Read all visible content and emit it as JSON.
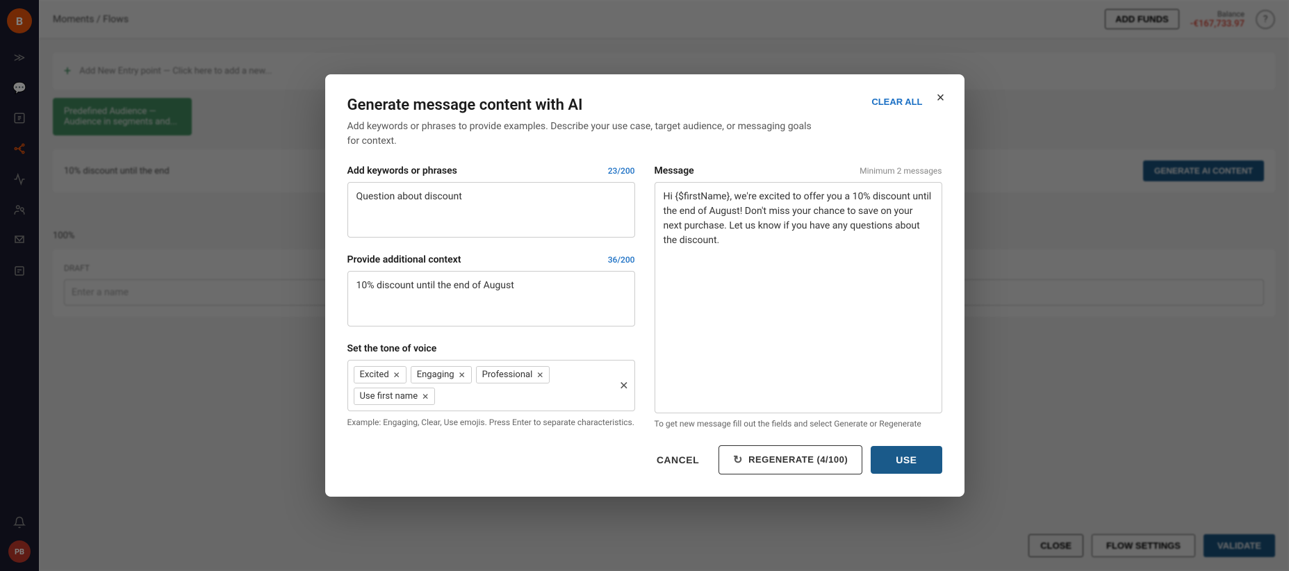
{
  "app": {
    "logo": "B",
    "nav_breadcrumb": "Moments / Flows",
    "add_funds_label": "ADD FUNDS",
    "balance_label": "Balance",
    "balance_amount": "-€167,733.97"
  },
  "sidebar": {
    "icons": [
      "≫",
      "💬",
      "📦",
      "📊",
      "📋",
      "🤖",
      "📈",
      "👥",
      "📩",
      "📑"
    ]
  },
  "modal": {
    "title": "Generate message content with AI",
    "subtitle": "Add keywords or phrases to provide examples. Describe your use case, target audience,\nor messaging goals for context.",
    "clear_all_label": "CLEAR ALL",
    "close_label": "×",
    "keywords_label": "Add keywords or phrases",
    "keywords_count": "23/200",
    "keywords_value": "Question about discount",
    "context_label": "Provide additional context",
    "context_count": "36/200",
    "context_value": "10% discount until the end of August",
    "tone_label": "Set the tone of voice",
    "tone_tags": [
      "Excited",
      "Engaging",
      "Professional",
      "Use first name"
    ],
    "tone_hint": "Example: Engaging, Clear, Use emojis. Press Enter to separate\ncharacteristics.",
    "message_label": "Message",
    "message_min": "Minimum 2 messages",
    "message_value": "Hi {$firstName}, we're excited to offer you a 10% discount until the end of August! Don't miss your chance to save on your next purchase. Let us know if you have any questions about the discount.",
    "message_hint": "To get new message fill out the fields and select Generate or Regenerate",
    "cancel_label": "CANCEL",
    "regenerate_label": "REGENERATE (4/100)",
    "use_label": "USE"
  }
}
